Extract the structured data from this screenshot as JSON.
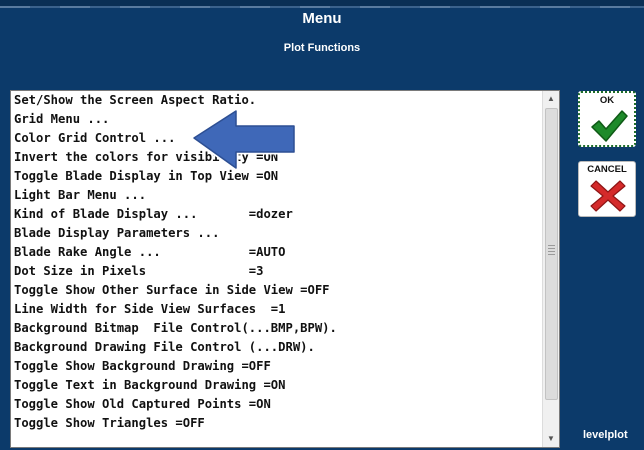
{
  "header": {
    "title": "Menu",
    "subtitle": "Plot Functions"
  },
  "menu_items": [
    "Set/Show the Screen Aspect Ratio.",
    "Grid Menu ...",
    "Color Grid Control ...",
    "Invert the colors for visibility =ON",
    "Toggle Blade Display in Top View =ON",
    "Light Bar Menu ...",
    "Kind of Blade Display ...       =dozer",
    "Blade Display Parameters ...",
    "Blade Rake Angle ...            =AUTO",
    "Dot Size in Pixels              =3",
    "Toggle Show Other Surface in Side View =OFF",
    "Line Width for Side View Surfaces  =1",
    "Background Bitmap  File Control(...BMP,BPW).",
    "Background Drawing File Control (...DRW).",
    "Toggle Show Background Drawing =OFF",
    "Toggle Text in Background Drawing =ON",
    "Toggle Show Old Captured Points =ON",
    "Toggle Show Triangles =OFF"
  ],
  "buttons": {
    "ok_label": "OK",
    "cancel_label": "CANCEL"
  },
  "icons": {
    "ok": "checkmark-icon",
    "cancel": "x-icon",
    "pointer": "left-arrow-icon",
    "ok_color": "#1e8a2a",
    "cancel_color": "#d42a2a",
    "pointer_color": "#3f68b8"
  },
  "brand": "levelplot",
  "colors": {
    "background": "#0c3a6a",
    "list_background": "#ffffff"
  }
}
